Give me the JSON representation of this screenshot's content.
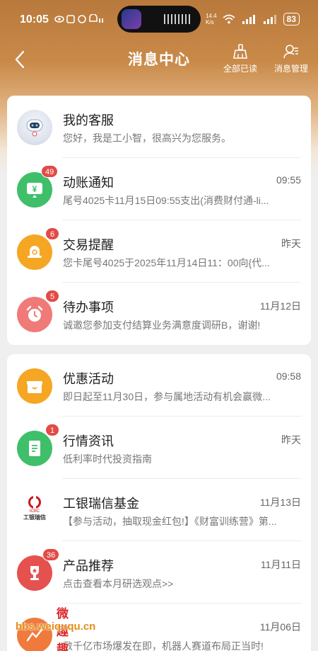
{
  "status_bar": {
    "time": "10:05",
    "network_speed": "14.4\nK/s",
    "battery": "83"
  },
  "nav": {
    "title": "消息中心",
    "read_all_label": "全部已读",
    "manage_label": "消息管理"
  },
  "group1": [
    {
      "title": "我的客服",
      "desc": "您好，我是工小智，很高兴为您服务。",
      "time": "",
      "badge": ""
    },
    {
      "title": "动账通知",
      "desc": "尾号4025卡11月15日09:55支出(消费财付通-li...",
      "time": "09:55",
      "badge": "49"
    },
    {
      "title": "交易提醒",
      "desc": "您卡尾号4025于2025年11月14日11：00向{代...",
      "time": "昨天",
      "badge": "6"
    },
    {
      "title": "待办事项",
      "desc": "诚邀您参加支付结算业务满意度调研B，谢谢!",
      "time": "11月12日",
      "badge": "5"
    }
  ],
  "group2": [
    {
      "title": "优惠活动",
      "desc": "即日起至11月30日，参与属地活动有机会赢微...",
      "time": "09:58",
      "badge": ""
    },
    {
      "title": "行情资讯",
      "desc": "低利率时代投资指南",
      "time": "昨天",
      "badge": "1"
    },
    {
      "title": "工银瑞信基金",
      "desc": "【参与活动，抽取现金红包!】《财富训练营》第...",
      "time": "11月13日",
      "badge": ""
    },
    {
      "title": "产品推荐",
      "desc": "点击查看本月研选观点>>",
      "time": "11月11日",
      "badge": "36"
    },
    {
      "title": "",
      "desc": "数千亿市场爆发在即，机器人赛道布局正当时!",
      "time": "11月06日",
      "badge": ""
    }
  ],
  "icbc_logo": {
    "en": "ICBC",
    "cn": "工银瑞信"
  },
  "watermark": {
    "title": "微趣趣",
    "url": "bbs.weiququ.cn"
  },
  "colors": {
    "header": "#c07f3f",
    "badge": "#e24b46",
    "green": "#3fbf6a",
    "orange": "#f5a623",
    "pink": "#f07a78",
    "red": "#e5514f"
  }
}
